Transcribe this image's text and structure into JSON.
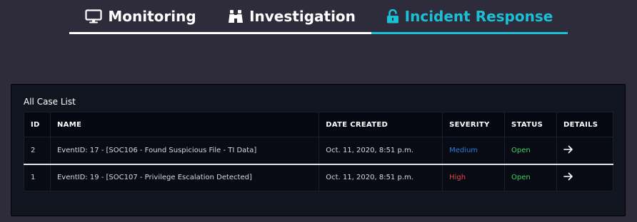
{
  "nav": {
    "tabs": [
      {
        "label": "Monitoring",
        "icon": "monitor-icon"
      },
      {
        "label": "Investigation",
        "icon": "binoculars-icon"
      },
      {
        "label": "Incident Response",
        "icon": "unlock-icon",
        "active": true
      }
    ]
  },
  "colors": {
    "accent": "#1cc0d6",
    "severity_medium": "#2f7bd6",
    "severity_high": "#e0474a",
    "status_open": "#3fd160"
  },
  "case_list": {
    "title": "All Case List",
    "headers": {
      "id": "ID",
      "name": "NAME",
      "date_created": "DATE CREATED",
      "severity": "SEVERITY",
      "status": "STATUS",
      "details": "DETAILS"
    },
    "rows": [
      {
        "id": "2",
        "name": "EventID: 17 - [SOC106 - Found Suspicious File - TI Data]",
        "date_created": "Oct. 11, 2020, 8:51 p.m.",
        "severity": "Medium",
        "status": "Open",
        "details_icon": "arrow-right-icon"
      },
      {
        "id": "1",
        "name": "EventID: 19 - [SOC107 - Privilege Escalation Detected]",
        "date_created": "Oct. 11, 2020, 8:51 p.m.",
        "severity": "High",
        "status": "Open",
        "details_icon": "arrow-right-icon"
      }
    ]
  }
}
